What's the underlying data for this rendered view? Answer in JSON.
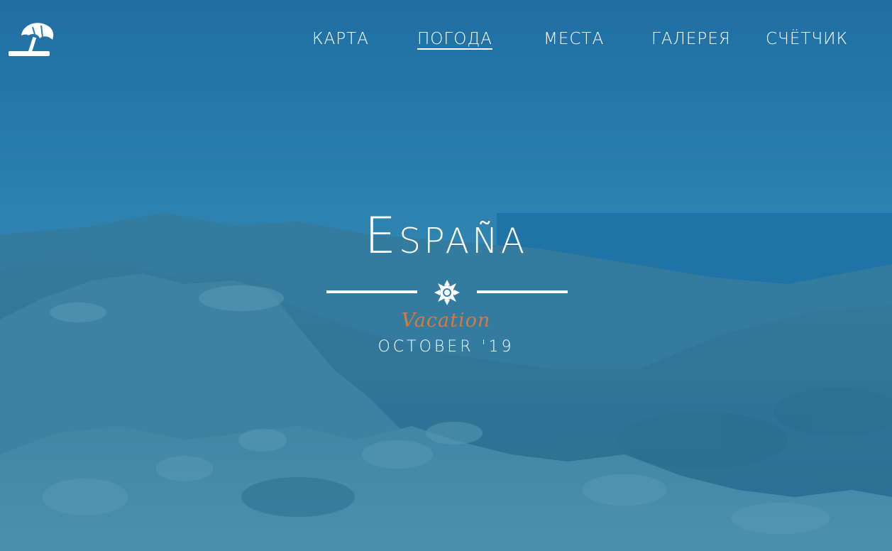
{
  "nav": {
    "items": [
      {
        "label": "КАРТА"
      },
      {
        "label": "ПОГОДА"
      },
      {
        "label": "МЕСТА"
      },
      {
        "label": "ГАЛЕРЕЯ"
      },
      {
        "label": "СЧЁТЧИК"
      }
    ],
    "active_index": 1
  },
  "hero": {
    "title": "España",
    "subtitle": "Vacation",
    "date": "OCTOBER '19"
  },
  "icons": {
    "logo": "beach-umbrella-icon",
    "divider_center": "sun-icon"
  },
  "colors": {
    "overlay": "#1e6fa3",
    "subtitle": "#d97a3a",
    "text": "#ffffff"
  }
}
